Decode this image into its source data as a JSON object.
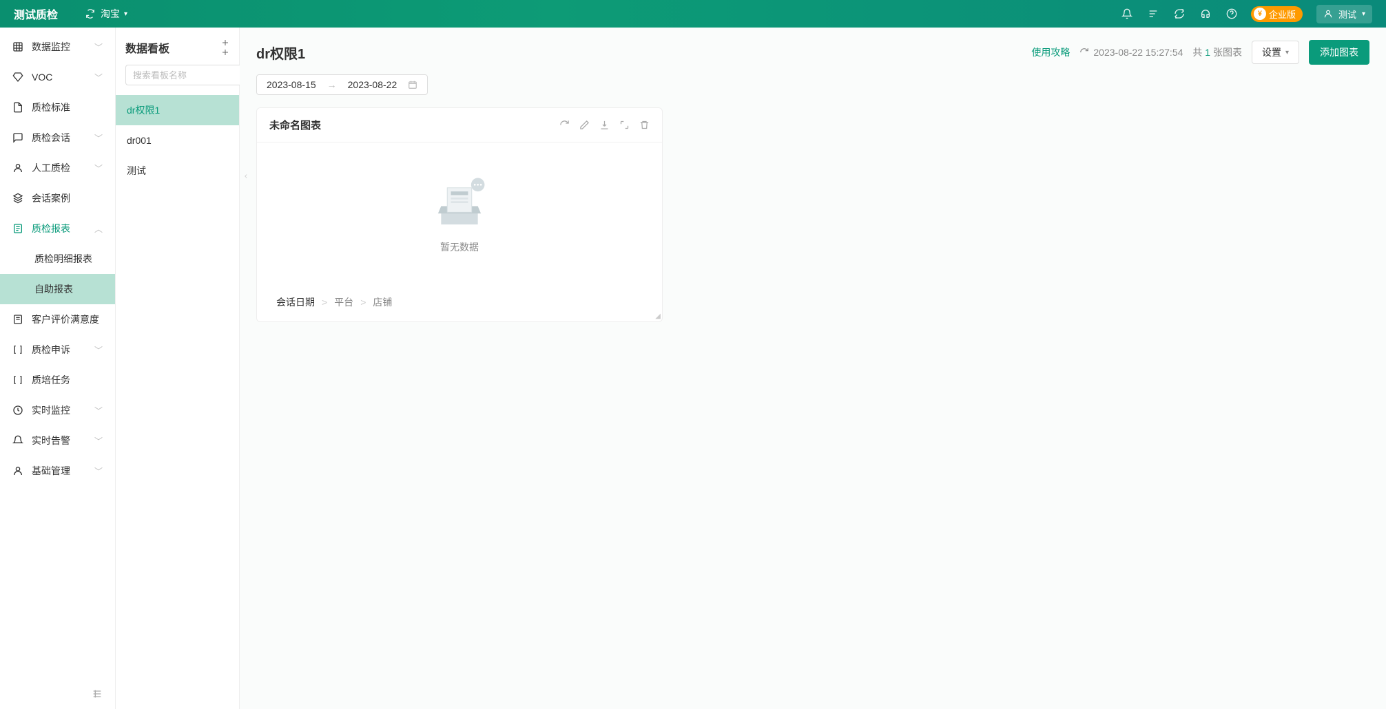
{
  "header": {
    "app_name": "测试质检",
    "platform_label": "淘宝",
    "badge_label": "企业版",
    "user_label": "测试"
  },
  "nav": {
    "items": [
      {
        "label": "数据监控",
        "chev": true
      },
      {
        "label": "VOC",
        "chev": true
      },
      {
        "label": "质检标准",
        "chev": false
      },
      {
        "label": "质检会话",
        "chev": true
      },
      {
        "label": "人工质检",
        "chev": true
      },
      {
        "label": "会话案例",
        "chev": false
      },
      {
        "label": "质检报表",
        "chev": true,
        "active": true
      },
      {
        "label": "质检明细报表",
        "sub": true
      },
      {
        "label": "自助报表",
        "sub": true,
        "selected": true
      },
      {
        "label": "客户评价满意度",
        "chev": false
      },
      {
        "label": "质检申诉",
        "chev": true
      },
      {
        "label": "质培任务",
        "chev": false
      },
      {
        "label": "实时监控",
        "chev": true
      },
      {
        "label": "实时告警",
        "chev": true
      },
      {
        "label": "基础管理",
        "chev": true
      }
    ]
  },
  "boards": {
    "title": "数据看板",
    "search_placeholder": "搜索看板名称",
    "items": [
      "dr权限1",
      "dr001",
      "测试"
    ],
    "active_index": 0
  },
  "main": {
    "title": "dr权限1",
    "guide_label": "使用攻略",
    "timestamp": "2023-08-22 15:27:54",
    "count_prefix": "共",
    "count_num": "1",
    "count_suffix": "张图表",
    "settings_label": "设置",
    "add_chart_label": "添加图表",
    "date_start": "2023-08-15",
    "date_end": "2023-08-22"
  },
  "chart": {
    "title": "未命名图表",
    "empty_text": "暂无数据",
    "dims": [
      "会话日期",
      "平台",
      "店铺"
    ]
  }
}
